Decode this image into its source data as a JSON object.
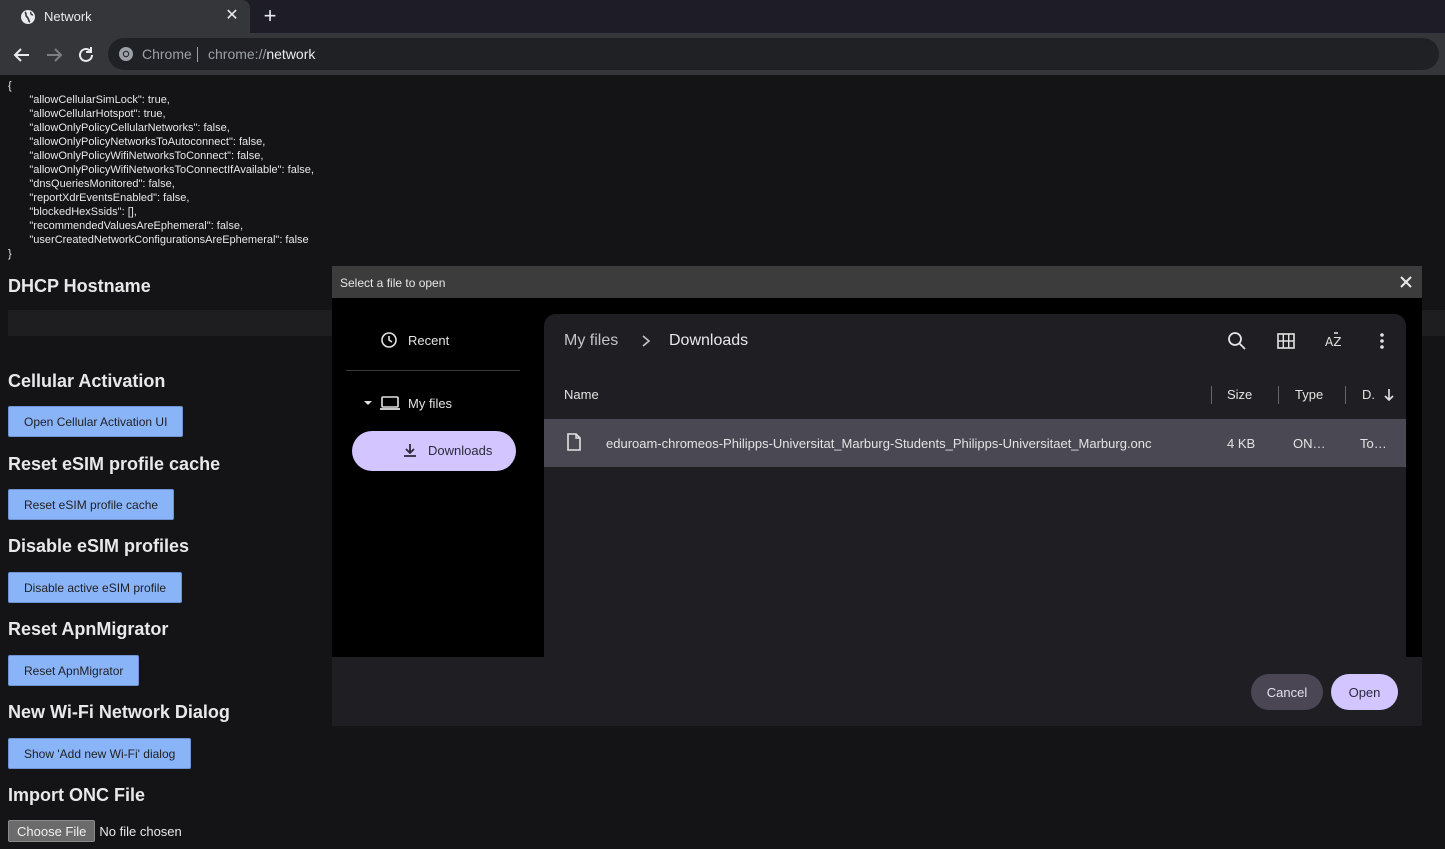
{
  "browser": {
    "tab_title": "Network",
    "omnibox_scheme_label": "Chrome",
    "omnibox_url_prefix": "chrome://",
    "omnibox_url_host": "network"
  },
  "page": {
    "json_text": "{\n       \"allowCellularSimLock\": true,\n       \"allowCellularHotspot\": true,\n       \"allowOnlyPolicyCellularNetworks\": false,\n       \"allowOnlyPolicyNetworksToAutoconnect\": false,\n       \"allowOnlyPolicyWifiNetworksToConnect\": false,\n       \"allowOnlyPolicyWifiNetworksToConnectIfAvailable\": false,\n       \"dnsQueriesMonitored\": false,\n       \"reportXdrEventsEnabled\": false,\n       \"blockedHexSsids\": [],\n       \"recommendedValuesAreEphemeral\": false,\n       \"userCreatedNetworkConfigurationsAreEphemeral\": false\n}",
    "dhcp_heading": "DHCP Hostname",
    "cellular_heading": "Cellular Activation",
    "cellular_button": "Open Cellular Activation UI",
    "esim_cache_heading": "Reset eSIM profile cache",
    "esim_cache_button": "Reset eSIM profile cache",
    "disable_esim_heading": "Disable eSIM profiles",
    "disable_esim_button": "Disable active eSIM profile",
    "apn_heading": "Reset ApnMigrator",
    "apn_button": "Reset ApnMigrator",
    "wifi_heading": "New Wi-Fi Network Dialog",
    "wifi_button": "Show 'Add new Wi-Fi' dialog",
    "onc_heading": "Import ONC File",
    "choose_file_label": "Choose File",
    "no_file_label": "No file chosen"
  },
  "dialog": {
    "title": "Select a file to open",
    "nav": {
      "recent": "Recent",
      "my_files": "My files",
      "downloads": "Downloads"
    },
    "breadcrumb": [
      "My files",
      "Downloads"
    ],
    "columns": {
      "name": "Name",
      "size": "Size",
      "type": "Type",
      "date": "D."
    },
    "files": [
      {
        "name": "eduroam-chromeos-Philipps-Universitat_Marburg-Students_Philipps-Universitaet_Marburg.onc",
        "size": "4 KB",
        "type": "ON…",
        "date": "To…"
      }
    ],
    "cancel_label": "Cancel",
    "open_label": "Open",
    "colors": {
      "accent": "#d3c5ff",
      "selected_row": "#4a4953"
    }
  }
}
